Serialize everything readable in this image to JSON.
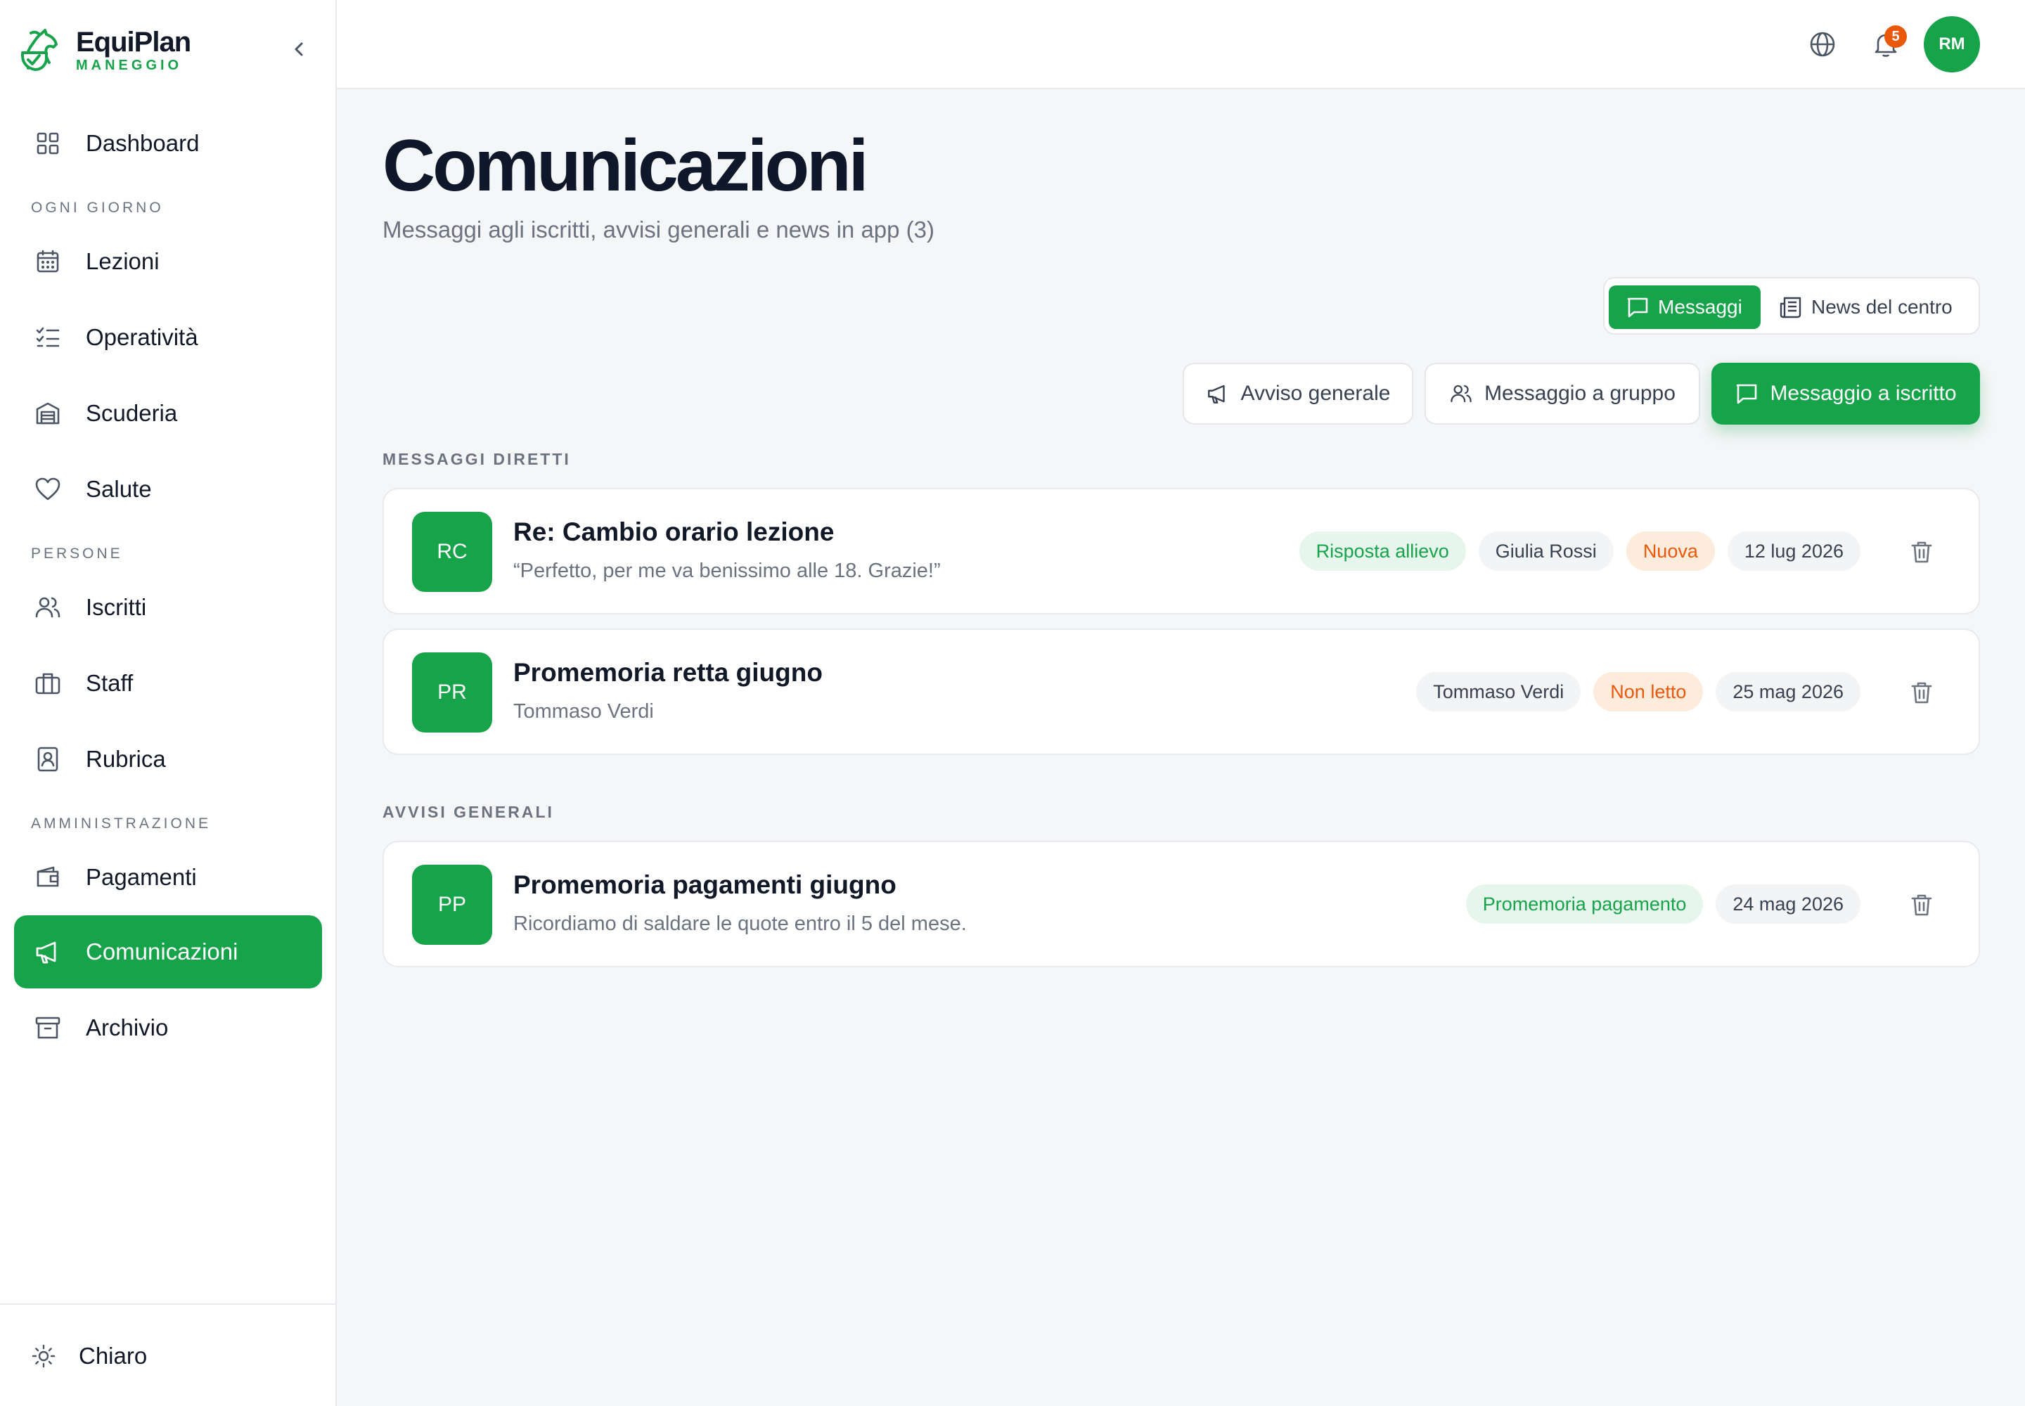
{
  "app": {
    "brand_name": "EquiPlan",
    "brand_sub": "MANEGGIO"
  },
  "sidebar": {
    "dashboard": "Dashboard",
    "section_daily": "OGNI GIORNO",
    "lezioni": "Lezioni",
    "operativita": "Operatività",
    "scuderia": "Scuderia",
    "salute": "Salute",
    "section_people": "PERSONE",
    "iscritti": "Iscritti",
    "staff": "Staff",
    "rubrica": "Rubrica",
    "section_admin": "AMMINISTRAZIONE",
    "pagamenti": "Pagamenti",
    "comunicazioni": "Comunicazioni",
    "archivio": "Archivio",
    "theme": "Chiaro"
  },
  "topbar": {
    "notifications_count": "5",
    "user_initials": "RM"
  },
  "page": {
    "title": "Comunicazioni",
    "subtitle": "Messaggi agli iscritti, avvisi generali e news in app (3)"
  },
  "tabs": {
    "messages": "Messaggi",
    "news": "News del centro"
  },
  "actions": {
    "general_notice": "Avviso generale",
    "group_message": "Messaggio a gruppo",
    "member_message": "Messaggio a iscritto"
  },
  "direct": {
    "label": "MESSAGGI DIRETTI",
    "items": [
      {
        "initials": "RC",
        "title": "Re: Cambio orario lezione",
        "subtitle": "“Perfetto, per me va benissimo alle 18. Grazie!”",
        "tags": [
          "Risposta allievo",
          "Giulia Rossi",
          "Nuova",
          "12 lug 2026"
        ]
      },
      {
        "initials": "PR",
        "title": "Promemoria retta giugno",
        "subtitle": "Tommaso Verdi",
        "tags": [
          "Tommaso Verdi",
          "Non letto",
          "25 mag 2026"
        ]
      }
    ]
  },
  "general": {
    "label": "AVVISI GENERALI",
    "items": [
      {
        "initials": "PP",
        "title": "Promemoria pagamenti giugno",
        "subtitle": "Ricordiamo di saldare le quote entro il 5 del mese.",
        "tags": [
          "Promemoria pagamento",
          "24 mag 2026"
        ]
      }
    ]
  },
  "colors": {
    "accent": "#16a34a",
    "warning": "#ea580c",
    "background": "#f5f6f8"
  },
  "icons": {
    "brand": "horse-logo-icon",
    "collapse": "chevron-left-icon",
    "dashboard": "grid-icon",
    "lezioni": "calendar-icon",
    "operativita": "checklist-icon",
    "scuderia": "stable-icon",
    "salute": "heart-icon",
    "iscritti": "users-icon",
    "staff": "briefcase-icon",
    "rubrica": "contact-book-icon",
    "pagamenti": "wallet-icon",
    "comunicazioni": "megaphone-icon",
    "archivio": "archive-icon",
    "theme": "sun-icon",
    "language": "globe-icon",
    "notifications": "bell-icon",
    "messages_tab": "chat-icon",
    "news_tab": "newspaper-icon",
    "delete": "trash-icon"
  }
}
